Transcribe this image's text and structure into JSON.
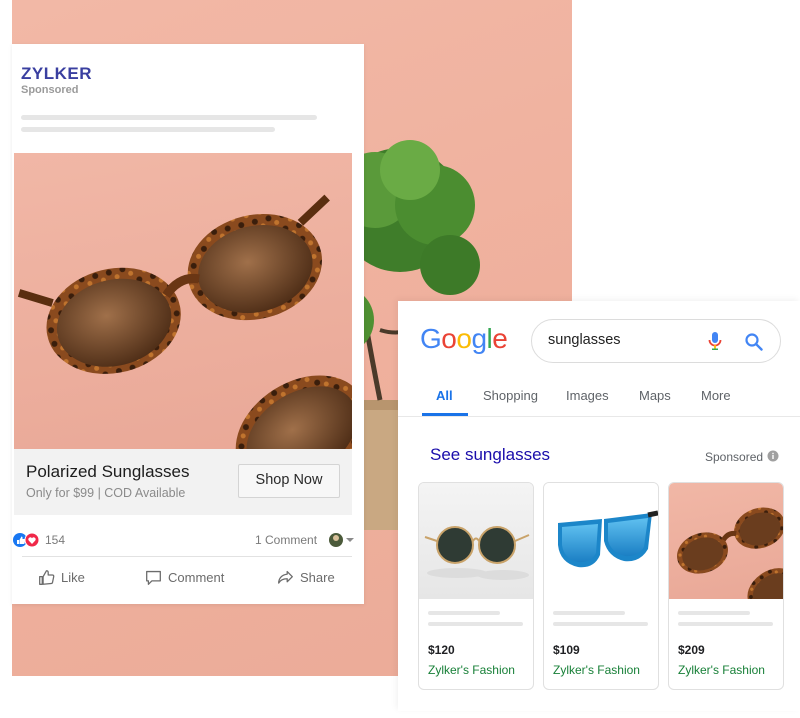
{
  "facebook_ad": {
    "brand": "ZYLKER",
    "sponsored": "Sponsored",
    "product_title": "Polarized Sunglasses",
    "product_subtitle": "Only for $99 | COD Available",
    "cta_label": "Shop Now",
    "reaction_count": "154",
    "comment_count": "1 Comment",
    "actions": {
      "like": "Like",
      "comment": "Comment",
      "share": "Share"
    }
  },
  "google": {
    "logo": [
      "G",
      "o",
      "o",
      "g",
      "l",
      "e"
    ],
    "logo_colors": [
      "#4285F4",
      "#EA4335",
      "#FBBC05",
      "#4285F4",
      "#34A853",
      "#EA4335"
    ],
    "search_query": "sunglasses",
    "tabs": [
      "All",
      "Shopping",
      "Images",
      "Maps",
      "More"
    ],
    "active_tab": "All",
    "shopping_title": "See sunglasses",
    "sponsored": "Sponsored",
    "products": [
      {
        "price": "$120",
        "store": "Zylker's Fashion"
      },
      {
        "price": "$109",
        "store": "Zylker's Fashion"
      },
      {
        "price": "$209",
        "store": "Zylker's Fashion"
      }
    ]
  },
  "colors": {
    "brand": "#3a3fa0",
    "backdrop": "#efb09d",
    "link_blue": "#1a0dab",
    "tab_blue": "#1a73e8",
    "store_green": "#188038"
  }
}
